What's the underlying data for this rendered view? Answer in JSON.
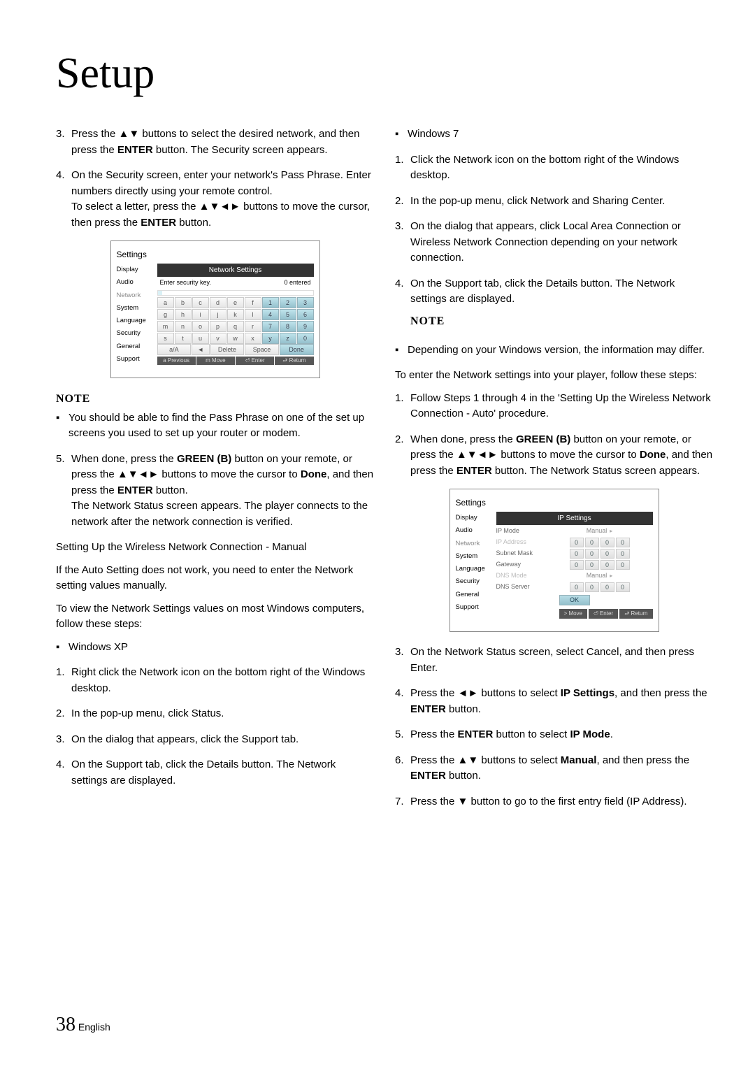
{
  "title": "Setup",
  "footer": {
    "page": "38",
    "lang": "English"
  },
  "left": {
    "s3_num": "3.",
    "s3": "Press the ▲▼ buttons to select the desired network, and then press the ",
    "s3_b": "ENTER ",
    "s3_c": "button. The Security screen appears.",
    "s4_num": "4.",
    "s4_a": "On the Security screen, enter your network's Pass Phrase. Enter numbers directly using your remote control.",
    "s4_b": "To select a letter, press the ▲▼◄► buttons to move the cursor, then press the ",
    "s4_b2": "ENTER ",
    "s4_b3": "button.",
    "note": "NOTE",
    "note_text": "You should be able to find the Pass Phrase on one of the set up screens you used to set up your router or modem.",
    "s5_num": "5.",
    "s5_a": "When done, press the ",
    "s5_b": "GREEN (B) ",
    "s5_c": "button on your remote, or press the ▲▼◄► buttons to move the cursor to ",
    "s5_d": "Done",
    "s5_e": ", and then press the ",
    "s5_f": "ENTER ",
    "s5_g": "button.",
    "s5_h": "The Network Status screen appears. The player connects to the network after the network connection is verified.",
    "manual_head": "Setting Up the Wireless Network Connection - Manual",
    "m1": "If the Auto Setting does not work, you need to enter the Network setting values manually.",
    "m2": "To view the Network Settings values on most Windows computers, follow these steps:",
    "wxp": "Windows XP",
    "x1n": "1.",
    "x1": "Right click the Network icon on the bottom right of the Windows desktop.",
    "x2n": "2.",
    "x2": "In the pop-up menu, click Status.",
    "x3n": "3.",
    "x3": "On the dialog that appears, click the Support tab.",
    "x4n": "4.",
    "x4": "On the Support tab, click the Details button. The Network settings are displayed."
  },
  "right": {
    "w7": "Windows 7",
    "w1n": "1.",
    "w1": "Click the Network icon on the bottom right of the Windows desktop.",
    "w2n": "2.",
    "w2": "In the pop-up menu, click Network and Sharing Center.",
    "w3n": "3.",
    "w3": "On the dialog that appears, click Local Area Connection or Wireless Network Connection depending on your network connection.",
    "w4n": "4.",
    "w4": "On the Support tab, click the Details button. The Network settings are displayed.",
    "note": "NOTE",
    "note_text": "Depending on your Windows version, the information may differ.",
    "enter": "To enter the Network settings into your player, follow these steps:",
    "e1n": "1.",
    "e1": "Follow Steps 1 through 4 in the 'Setting Up the Wireless Network Connection - Auto' procedure.",
    "e2n": "2.",
    "e2a": "When done, press the ",
    "e2b": "GREEN (B) ",
    "e2c": "button on your remote, or press the ▲▼◄► buttons to move the cursor to ",
    "e2d": "Done",
    "e2e": ", and then press the ",
    "e2f": "ENTER ",
    "e2g": "button. The Network Status screen appears.",
    "e3n": "3.",
    "e3": "On the Network Status screen, select Cancel, and then press Enter.",
    "e4n": "4.",
    "e4a": "Press the ◄► buttons to select ",
    "e4b": "IP Settings",
    "e4c": ", and then press the ",
    "e4d": "ENTER ",
    "e4e": "button.",
    "e5n": "5.",
    "e5a": "Press the ",
    "e5b": "ENTER ",
    "e5c": "button to select ",
    "e5d": "IP Mode",
    "e5e": ".",
    "e6n": "6.",
    "e6a": "Press the ▲▼ buttons to select ",
    "e6b": "Manual",
    "e6c": ", and then press the ",
    "e6d": "ENTER ",
    "e6e": "button.",
    "e7n": "7.",
    "e7": "Press the ▼ button to go to the first entry field (IP Address)."
  },
  "kb": {
    "title": "Settings",
    "header": "Network Settings",
    "prompt": "Enter security key.",
    "entered": "0 entered",
    "menu": [
      "Display",
      "Audio",
      "Network",
      "System",
      "Language",
      "Security",
      "General",
      "Support"
    ],
    "rows": [
      [
        "a",
        "b",
        "c",
        "d",
        "e",
        "f",
        "1",
        "2",
        "3"
      ],
      [
        "g",
        "h",
        "i",
        "j",
        "k",
        "l",
        "4",
        "5",
        "6"
      ],
      [
        "m",
        "n",
        "o",
        "p",
        "q",
        "r",
        "7",
        "8",
        "9"
      ],
      [
        "s",
        "t",
        "u",
        "v",
        "w",
        "x",
        "y",
        "z",
        "0"
      ]
    ],
    "bottom": [
      "a/A",
      "",
      "Delete",
      "Space",
      "Done"
    ],
    "hints": [
      "a Previous",
      "m Move",
      "⏎ Enter",
      "⮐ Return"
    ]
  },
  "ip": {
    "title": "Settings",
    "header": "IP Settings",
    "menu": [
      "Display",
      "Audio",
      "Network",
      "System",
      "Language",
      "Security",
      "General",
      "Support"
    ],
    "rows": [
      {
        "label": "IP Mode",
        "type": "text",
        "value": "Manual"
      },
      {
        "label": "IP Address",
        "type": "ip",
        "dim": true
      },
      {
        "label": "Subnet Mask",
        "type": "ip"
      },
      {
        "label": "Gateway",
        "type": "ip"
      },
      {
        "label": "DNS Mode",
        "type": "text",
        "value": "Manual",
        "dim": true
      },
      {
        "label": "DNS Server",
        "type": "ip"
      }
    ],
    "ok": "OK",
    "hints": [
      "> Move",
      "⏎ Enter",
      "⮐ Return"
    ]
  }
}
